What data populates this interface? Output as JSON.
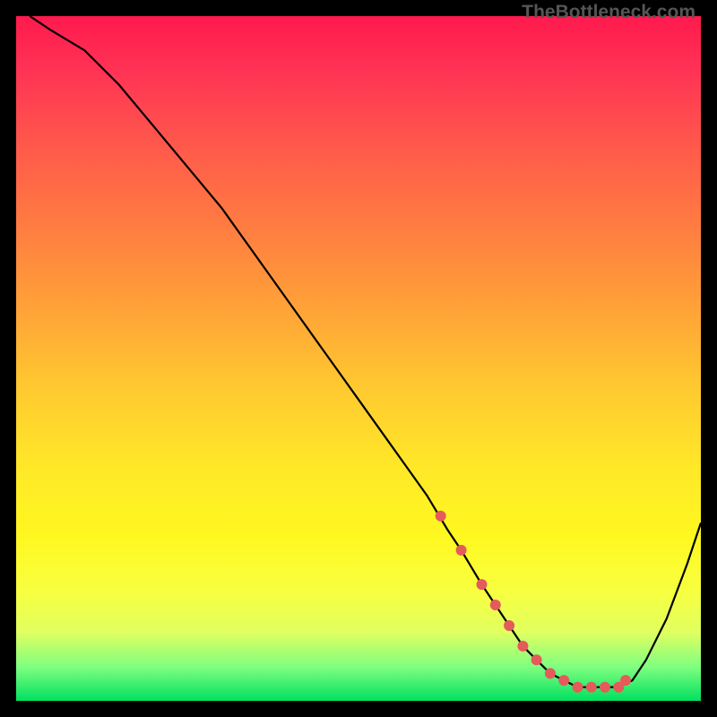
{
  "watermark": "TheBottleneck.com",
  "chart_data": {
    "type": "line",
    "title": "",
    "xlabel": "",
    "ylabel": "",
    "xlim": [
      0,
      100
    ],
    "ylim": [
      0,
      100
    ],
    "series": [
      {
        "name": "curve",
        "x": [
          2,
          5,
          10,
          15,
          20,
          25,
          30,
          35,
          40,
          45,
          50,
          55,
          60,
          63,
          65,
          68,
          70,
          72,
          74,
          76,
          78,
          80,
          82,
          84,
          86,
          88,
          90,
          92,
          95,
          98,
          100
        ],
        "values": [
          100,
          98,
          95,
          90,
          84,
          78,
          72,
          65,
          58,
          51,
          44,
          37,
          30,
          25,
          22,
          17,
          14,
          11,
          8,
          6,
          4,
          3,
          2,
          2,
          2,
          2,
          3,
          6,
          12,
          20,
          26
        ]
      }
    ],
    "markers": {
      "name": "highlight-dots",
      "color": "#e55a5a",
      "x": [
        62,
        65,
        68,
        70,
        72,
        74,
        76,
        78,
        80,
        82,
        84,
        86,
        88,
        89
      ],
      "values": [
        27,
        22,
        17,
        14,
        11,
        8,
        6,
        4,
        3,
        2,
        2,
        2,
        2,
        3
      ]
    }
  }
}
